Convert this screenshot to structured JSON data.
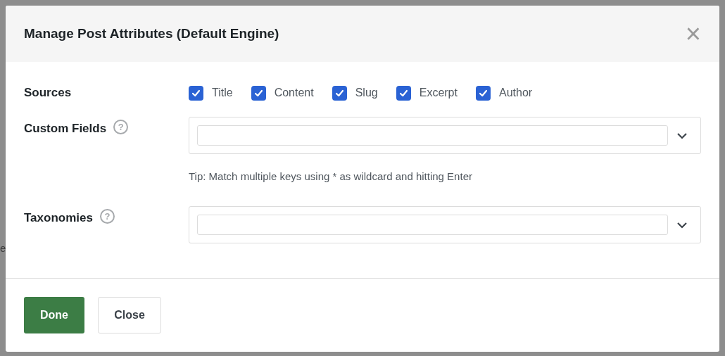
{
  "background": {
    "fragments": [
      "e"
    ]
  },
  "dialog": {
    "title": "Manage Post Attributes (Default Engine)",
    "close_icon": "×",
    "sources": {
      "label": "Sources",
      "options": [
        {
          "label": "Title",
          "checked": true
        },
        {
          "label": "Content",
          "checked": true
        },
        {
          "label": "Slug",
          "checked": true
        },
        {
          "label": "Excerpt",
          "checked": true
        },
        {
          "label": "Author",
          "checked": true
        }
      ]
    },
    "custom_fields": {
      "label": "Custom Fields",
      "help": "?",
      "tip": "Tip: Match multiple keys using * as wildcard and hitting Enter"
    },
    "taxonomies": {
      "label": "Taxonomies",
      "help": "?"
    },
    "buttons": [
      {
        "label": "Done",
        "kind": "primary"
      },
      {
        "label": "Close",
        "kind": "secondary"
      }
    ]
  }
}
